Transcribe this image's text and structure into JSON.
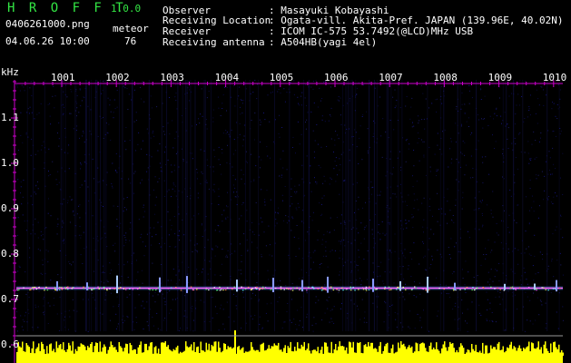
{
  "header": {
    "app_name": "H R O F F T",
    "version": "1.0.0",
    "file_name": "0406261000.png",
    "timestamp": "04.06.26 10:00",
    "meteor_label": "meteor",
    "meteor_count": "76"
  },
  "info": [
    {
      "key": "Observer",
      "value": ": Masayuki Kobayashi"
    },
    {
      "key": "Receiving Location",
      "value": ": Ogata-vill. Akita-Pref. JAPAN (139.96E, 40.02N)"
    },
    {
      "key": "Receiver",
      "value": ": ICOM IC-575 53.7492(@LCD)MHz USB"
    },
    {
      "key": "Receiving antenna",
      "value": ": A504HB(yagi 4el)"
    }
  ],
  "colors": {
    "background": "#000000",
    "title_green": "#33e644",
    "axis_magenta": "#cc00cc",
    "carrier_line": "#ff66ff",
    "baseline_gray": "#9a9a9a",
    "noise_bars": "#ffff00"
  },
  "chart_data": {
    "type": "heatmap",
    "y_unit": "kHz",
    "y_ticks": [
      "1.1",
      "1.0",
      "0.9",
      "0.8",
      "0.7",
      "0.6"
    ],
    "x_ticks": [
      "1001",
      "1002",
      "1003",
      "1004",
      "1005",
      "1006",
      "1007",
      "1008",
      "1009",
      "1010"
    ],
    "ylim": [
      0.59,
      1.15
    ],
    "carrier_khz": 0.725,
    "grid": false
  }
}
